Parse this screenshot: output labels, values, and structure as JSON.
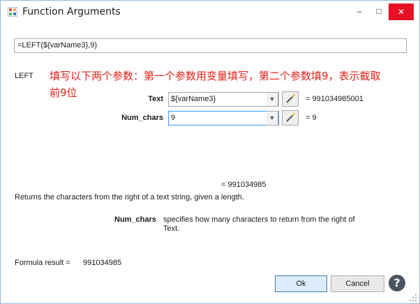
{
  "window": {
    "title": "Function Arguments"
  },
  "titlebar": {
    "minimize": "–",
    "maximize": "□",
    "close": "✕"
  },
  "formula": {
    "value": "=LEFT(${varName3},9)"
  },
  "function": {
    "name": "LEFT"
  },
  "note": {
    "text": "填写以下两个参数：第一个参数用变量填写，第二个参数填9，表示截取前9位"
  },
  "args": [
    {
      "label": "Text",
      "value": "${varName3}",
      "result": "=  991034985001"
    },
    {
      "label": "Num_chars",
      "value": "9",
      "result": "=  9"
    }
  ],
  "result_line": "=  991034985",
  "description": "Returns the characters from the right of a text string, given a length.",
  "param_help": {
    "name": "Num_chars",
    "text": "specifies how many characters to return from the right of Text."
  },
  "formula_result": {
    "label": "Formula result =",
    "value": "991034985"
  },
  "buttons": {
    "ok": "Ok",
    "cancel": "Cancel"
  },
  "colors": {
    "accent": "#3399ff",
    "note_red": "#e2231a",
    "close_red": "#e81123"
  }
}
